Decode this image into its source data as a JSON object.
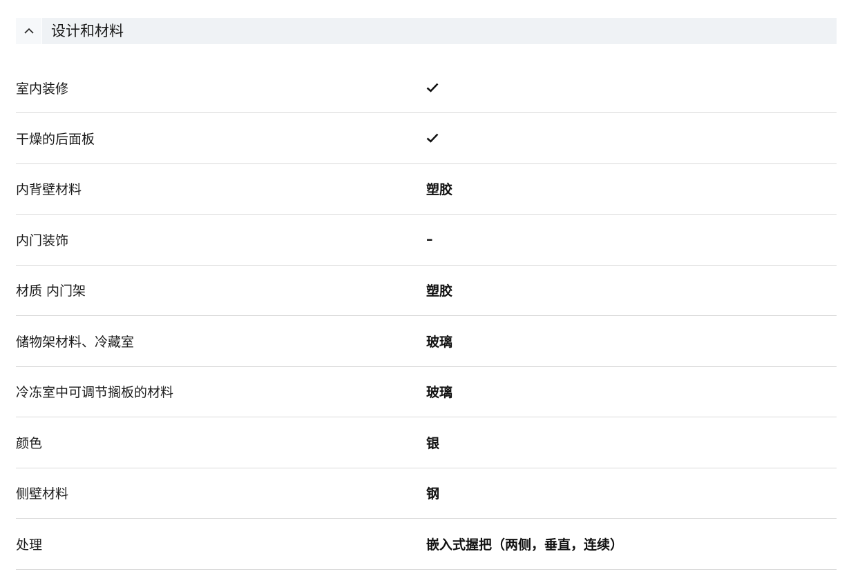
{
  "section": {
    "title": "设计和材料",
    "toggle_icon": "chevron-up-icon",
    "rows": [
      {
        "label": "室内装修",
        "value": "",
        "check": true
      },
      {
        "label": "干燥的后面板",
        "value": "",
        "check": true
      },
      {
        "label": "内背壁材料",
        "value": "塑胶",
        "check": false
      },
      {
        "label": "内门装饰",
        "value": "–",
        "check": false
      },
      {
        "label": "材质 内门架",
        "value": "塑胶",
        "check": false
      },
      {
        "label": "储物架材料、冷藏室",
        "value": "玻璃",
        "check": false
      },
      {
        "label": "冷冻室中可调节搁板的材料",
        "value": "玻璃",
        "check": false
      },
      {
        "label": "颜色",
        "value": "银",
        "check": false
      },
      {
        "label": "侧壁材料",
        "value": "钢",
        "check": false
      },
      {
        "label": "处理",
        "value": "嵌入式握把（两侧，垂直，连续）",
        "check": false
      }
    ]
  }
}
